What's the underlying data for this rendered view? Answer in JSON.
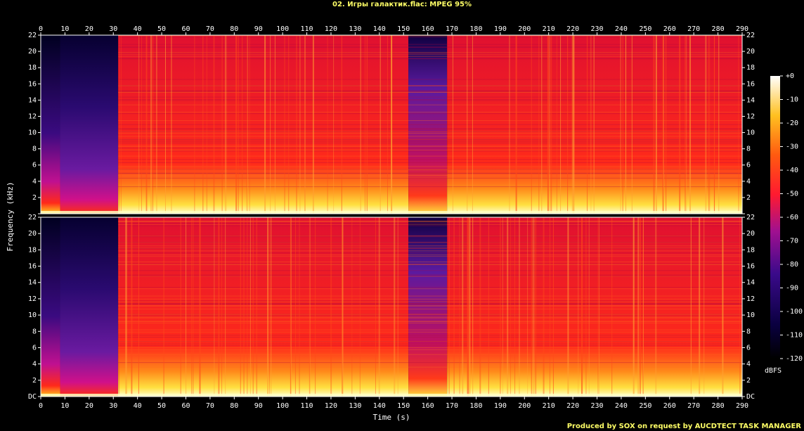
{
  "title": "02. Игры галактик.flac: MPEG 95%",
  "footer": "Produced by SOX on request by AUCDTECT TASK MANAGER",
  "chart_data": {
    "type": "heatmap",
    "title": "02. Игры галактик.flac: MPEG 95%",
    "xlabel": "Time (s)",
    "ylabel": "Frequency (kHz)",
    "xlim": [
      0,
      290
    ],
    "ylim": [
      0,
      22
    ],
    "x_ticks": [
      "0",
      "10",
      "20",
      "30",
      "40",
      "50",
      "60",
      "70",
      "80",
      "90",
      "100",
      "110",
      "120",
      "130",
      "140",
      "150",
      "160",
      "170",
      "180",
      "190",
      "200",
      "210",
      "220",
      "230",
      "240",
      "250",
      "260",
      "270",
      "280",
      "290"
    ],
    "y_ticks": [
      "DC",
      "2",
      "4",
      "6",
      "8",
      "10",
      "12",
      "14",
      "16",
      "18",
      "20",
      "22"
    ],
    "channels": 2,
    "colorbar": {
      "label": "dBFS",
      "ticks": [
        "+0",
        "-10",
        "-20",
        "-30",
        "-40",
        "-50",
        "-60",
        "-70",
        "-80",
        "-90",
        "-100",
        "-110",
        "-120"
      ],
      "range": [
        -120,
        0
      ]
    },
    "colors": {
      "loud": "#ffffe0",
      "mid": "#ff2a1a",
      "quiet": "#3a0a7a",
      "silence": "#000010",
      "title_text": "#ffff66"
    },
    "segments": [
      {
        "start": 0,
        "end": 8,
        "level": "quiet intro"
      },
      {
        "start": 8,
        "end": 32,
        "level": "fading in"
      },
      {
        "start": 32,
        "end": 152,
        "level": "full band"
      },
      {
        "start": 152,
        "end": 168,
        "level": "quiet bridge"
      },
      {
        "start": 168,
        "end": 290,
        "level": "full band"
      }
    ]
  }
}
